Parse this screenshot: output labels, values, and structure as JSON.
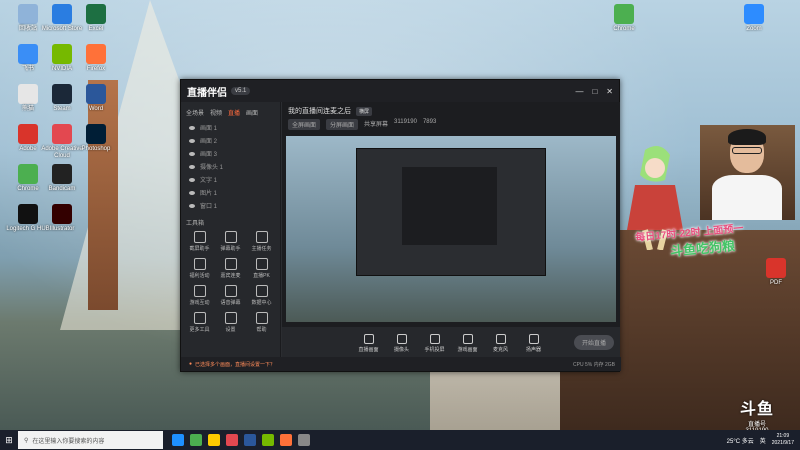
{
  "desktop_icons": [
    {
      "label": "回收站",
      "color": "#8fb3d9"
    },
    {
      "label": "飞书",
      "color": "#3a8ef6"
    },
    {
      "label": "熊猫",
      "color": "#e6e6e6"
    },
    {
      "label": "Adobe",
      "color": "#d9342b"
    },
    {
      "label": "Chrome",
      "color": "#4caf50"
    },
    {
      "label": "Logitech G HUB",
      "color": "#111111"
    },
    {
      "label": "Microsoft Store",
      "color": "#2a7de1"
    },
    {
      "label": "NVIDIA",
      "color": "#76b900"
    },
    {
      "label": "Steam",
      "color": "#1b2838"
    },
    {
      "label": "Adobe Creative Cloud",
      "color": "#e34850"
    },
    {
      "label": "Bandicam",
      "color": "#222222"
    },
    {
      "label": "Illustrator",
      "color": "#330000"
    },
    {
      "label": "Excel",
      "color": "#1d6f42"
    },
    {
      "label": "Firefox",
      "color": "#ff7139"
    },
    {
      "label": "Word",
      "color": "#2b579a"
    },
    {
      "label": "Photoshop",
      "color": "#001e36"
    }
  ],
  "desktop_right": [
    {
      "label": "Zoom",
      "color": "#2d8cff"
    },
    {
      "label": "Chrome",
      "color": "#4caf50"
    },
    {
      "label": "PDF",
      "color": "#d9342b"
    }
  ],
  "app": {
    "logo": "直播伴侣",
    "version": "v5.1",
    "window_controls": [
      "—",
      "□",
      "✕"
    ],
    "tabs": [
      "全场景",
      "视频",
      "直播",
      "画面"
    ],
    "active_tab": "直播",
    "sources": [
      "画面 1",
      "画面 2",
      "画面 3",
      "摄像头 1",
      "文字 1",
      "图片 1",
      "窗口 1"
    ],
    "tools_title": "工具箱",
    "tools": [
      "截屏助手",
      "弹幕助手",
      "主播任务",
      "福利活动",
      "嘉宾连麦",
      "直播PK",
      "游戏互动",
      "语音弹幕",
      "数据中心",
      "更多工具",
      "设置",
      "帮助"
    ],
    "preview_title": "我的直播间连麦之后",
    "preview_tag": "横屏",
    "preview_pills": [
      "全屏画面",
      "分屏画面",
      "共享屏幕",
      "3119190",
      "7893"
    ],
    "bottom_buttons": [
      "直播画面",
      "摄像头",
      "手机投屏",
      "游戏画面",
      "麦克风",
      "扬声器"
    ],
    "golive": "开始直播",
    "status_text": "已选择多个画面，直播间设置一下？",
    "status_right": "CPU 5%  内存 2GB"
  },
  "stream_overlay": {
    "line1": "每日17时-22时 上面预一",
    "line2": "斗鱼吃狗粮"
  },
  "watermark": {
    "brand": "斗鱼",
    "sub": "直播号",
    "room": "3119190"
  },
  "taskbar": {
    "start_icon": "windows-logo",
    "search_placeholder": "在这里输入你要搜索的内容",
    "weather": "25°C 多云",
    "ime": "英",
    "time": "21:09",
    "date": "2021/9/17"
  }
}
